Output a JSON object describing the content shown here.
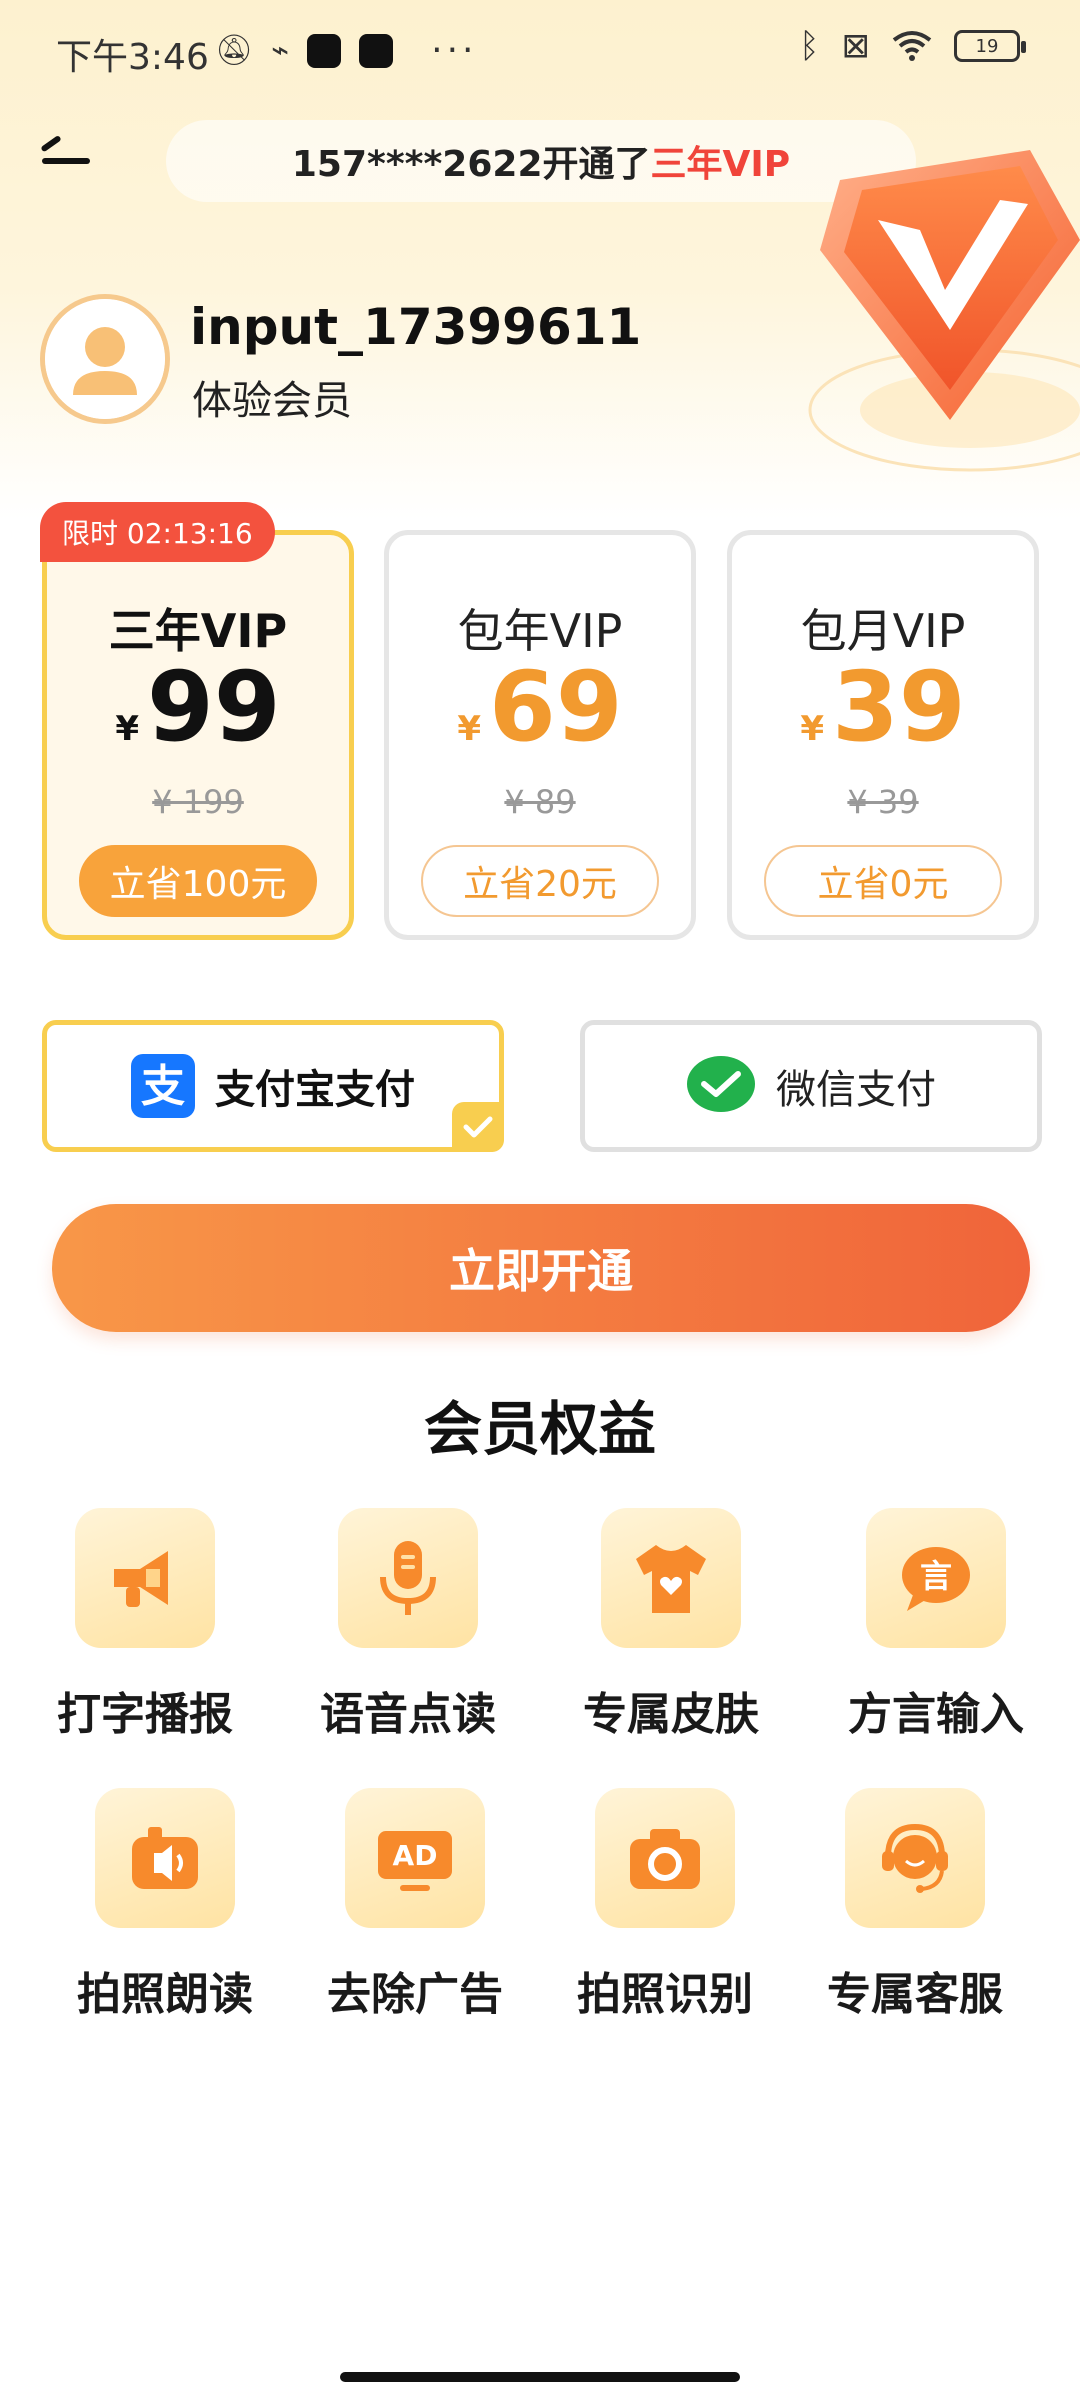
{
  "status_bar": {
    "time": "下午3:46",
    "battery": "19",
    "icons": [
      "mute-icon",
      "usb-icon",
      "app-icon",
      "app-icon",
      "more-icon",
      "bluetooth-icon",
      "sim-icon",
      "wifi-icon",
      "battery-icon"
    ]
  },
  "ticker": {
    "prefix": "157****2622开通了",
    "highlight": "三年VIP"
  },
  "user": {
    "name": "input_17399611",
    "level": "体验会员"
  },
  "plans": [
    {
      "name": "三年VIP",
      "currency": "¥",
      "price": "99",
      "original": "¥ 199",
      "save": "立省100元",
      "selected": true,
      "limit_label": "限时 02:13:16"
    },
    {
      "name": "包年VIP",
      "currency": "¥",
      "price": "69",
      "original": "¥ 89",
      "save": "立省20元",
      "selected": false
    },
    {
      "name": "包月VIP",
      "currency": "¥",
      "price": "39",
      "original": "¥ 39",
      "save": "立省0元",
      "selected": false
    }
  ],
  "payment": {
    "alipay": {
      "label": "支付宝支付",
      "icon": "alipay-icon",
      "selected": true
    },
    "wechat": {
      "label": "微信支付",
      "icon": "wechat-pay-icon",
      "selected": false
    }
  },
  "cta": {
    "label": "立即开通"
  },
  "benefits": {
    "title": "会员权益",
    "items": [
      {
        "label": "打字播报",
        "icon": "megaphone-icon"
      },
      {
        "label": "语音点读",
        "icon": "microphone-icon"
      },
      {
        "label": "专属皮肤",
        "icon": "tshirt-icon"
      },
      {
        "label": "方言输入",
        "icon": "speech-bubble-icon"
      },
      {
        "label": "拍照朗读",
        "icon": "camera-speaker-icon"
      },
      {
        "label": "去除广告",
        "icon": "ad-block-icon"
      },
      {
        "label": "拍照识别",
        "icon": "camera-icon"
      },
      {
        "label": "专属客服",
        "icon": "customer-service-icon"
      }
    ]
  },
  "colors": {
    "accent_orange": "#f29a2f",
    "cta_start": "#f89748",
    "cta_end": "#f0643a",
    "highlight_red": "#f0443a",
    "selected_border": "#f8ce4f"
  }
}
